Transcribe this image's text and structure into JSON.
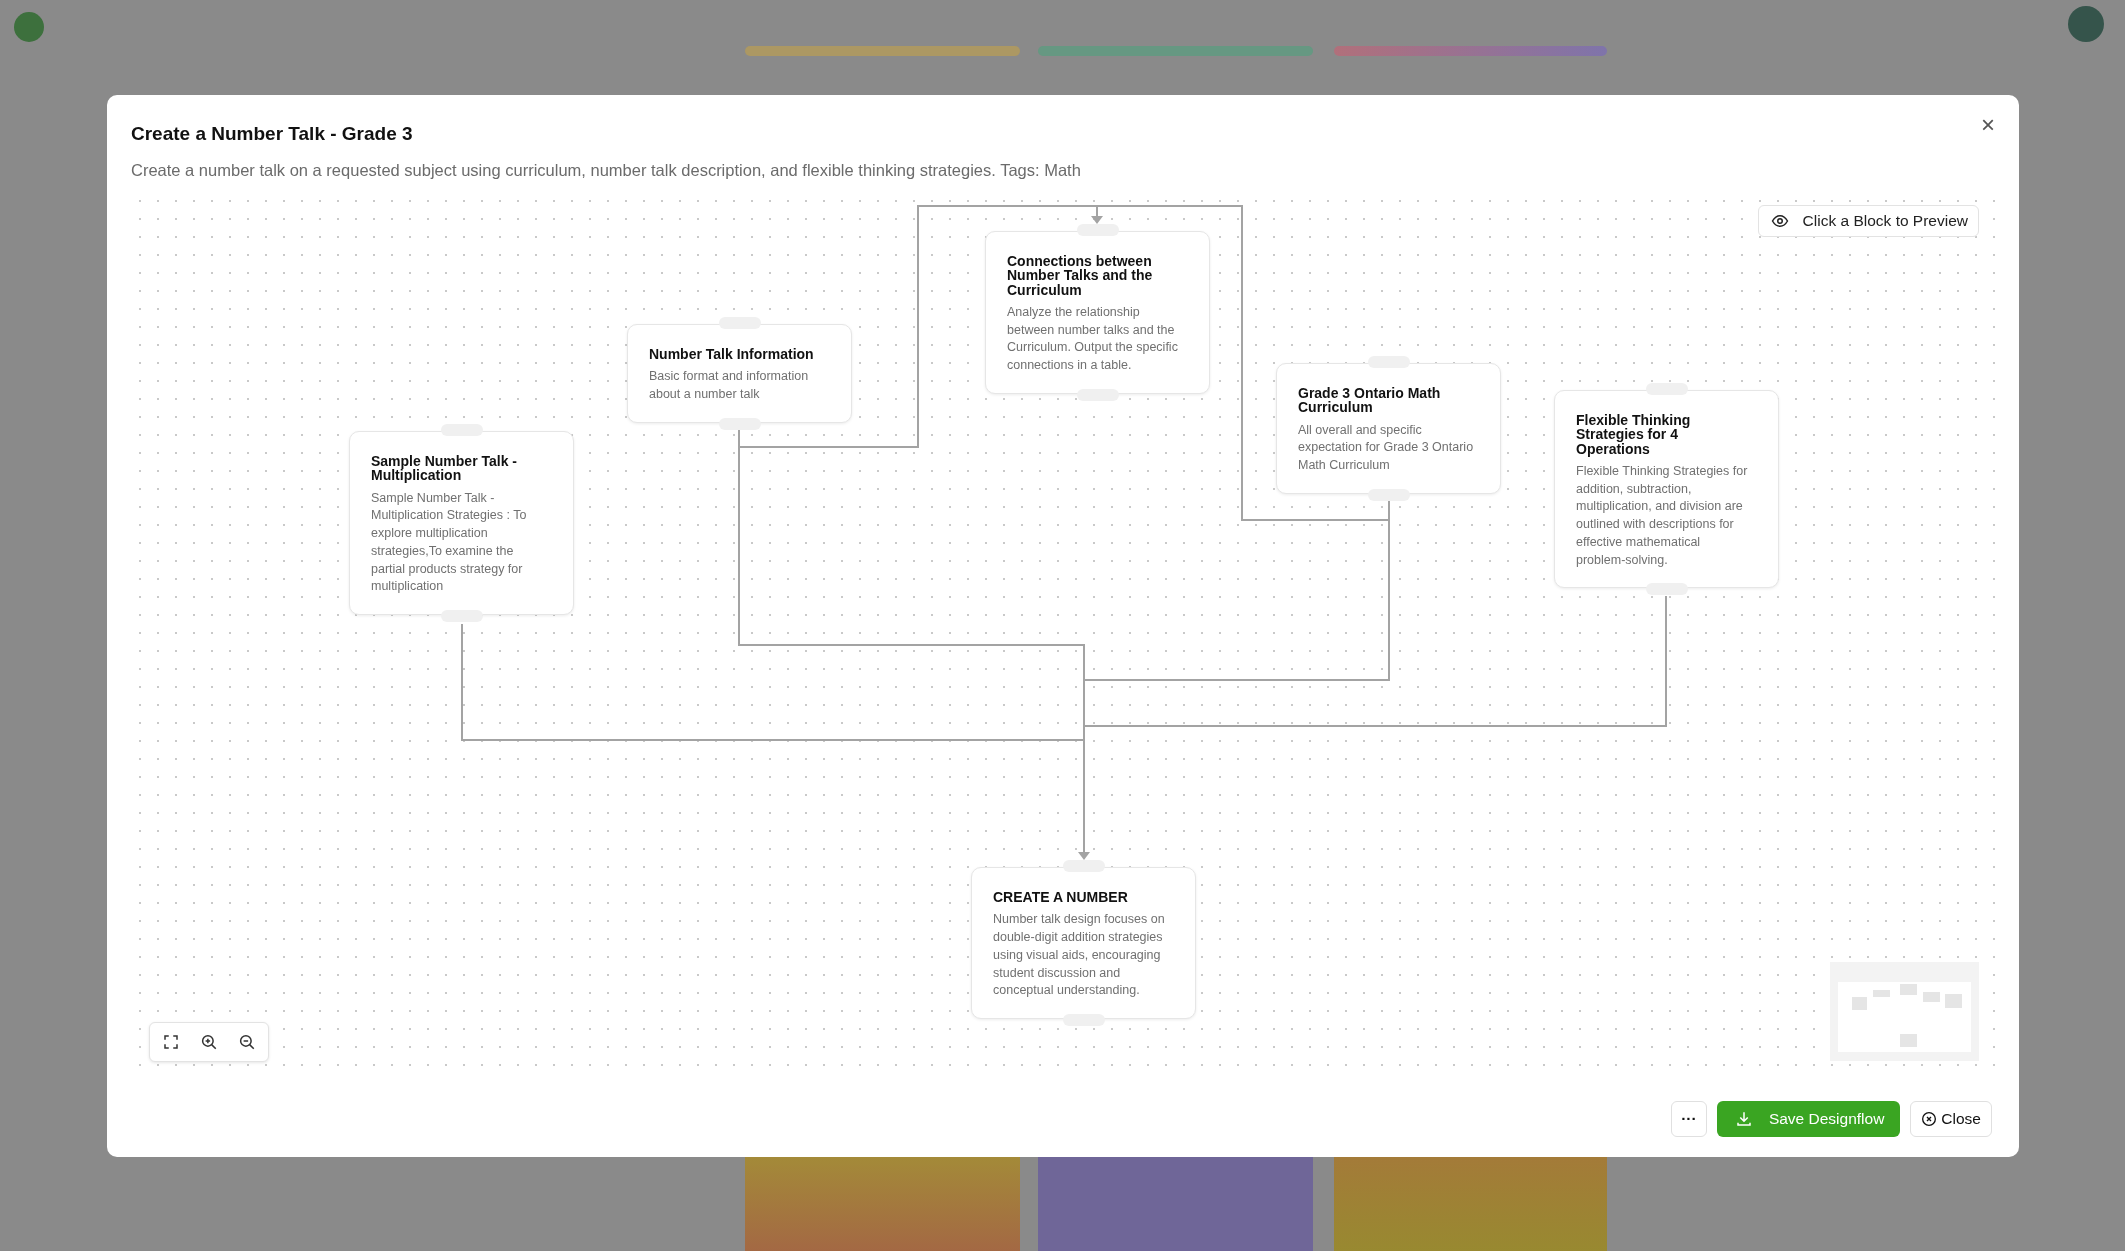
{
  "dialog": {
    "title": "Create a Number Talk - Grade 3",
    "description": "Create a number talk on a requested subject using curriculum, number talk description, and flexible thinking strategies. Tags: Math",
    "close_icon": "×"
  },
  "canvas": {
    "preview_button": "Click a Block to Preview",
    "blocks": [
      {
        "title": "Sample Number Talk - Multiplication",
        "description": "Sample Number Talk - Multiplication Strategies : To explore multiplication strategies,To examine the partial products strategy for multiplication"
      },
      {
        "title": "Number Talk Information",
        "description": "Basic format and information about a number talk"
      },
      {
        "title": "Connections between Number Talks and the Curriculum",
        "description": "Analyze the relationship between number talks and the Curriculum. Output the specific connections in a table."
      },
      {
        "title": "Grade 3 Ontario Math Curriculum",
        "description": "All overall and specific expectation for Grade 3 Ontario Math Curriculum"
      },
      {
        "title": "Flexible Thinking Strategies for 4 Operations",
        "description": "Flexible Thinking Strategies for addition, subtraction, multiplication, and division are outlined with descriptions for effective mathematical problem-solving."
      },
      {
        "title": "CREATE A NUMBER",
        "description": "Number talk design focuses on double-digit addition strategies using visual aids, encouraging student discussion and conceptual understanding."
      }
    ]
  },
  "footer": {
    "more_button": "···",
    "save_button": "Save Designflow",
    "close_button": "Close"
  }
}
